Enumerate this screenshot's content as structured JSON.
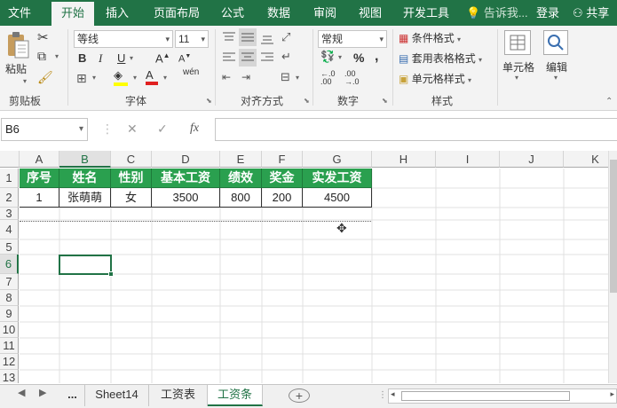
{
  "menu": {
    "tabs": [
      "文件",
      "开始",
      "插入",
      "页面布局",
      "公式",
      "数据",
      "审阅",
      "视图",
      "开发工具"
    ],
    "active_tab": "开始",
    "search": "告诉我...",
    "login": "登录",
    "share": "共享"
  },
  "ribbon": {
    "clipboard": {
      "paste": "粘贴",
      "label": "剪贴板"
    },
    "font": {
      "name": "等线",
      "size": "11",
      "label": "字体",
      "bold": "B",
      "italic": "I",
      "underline": "U",
      "grow": "A",
      "shrink": "A",
      "wen": "wén"
    },
    "alignment": {
      "label": "对齐方式"
    },
    "number": {
      "format": "常规",
      "label": "数字",
      "percent": "%",
      "comma": ","
    },
    "styles": {
      "conditional": "条件格式",
      "table": "套用表格格式",
      "cell": "单元格样式",
      "label": "样式"
    },
    "cells": {
      "label": "单元格"
    },
    "editing": {
      "label": "编辑"
    }
  },
  "formula_bar": {
    "name_box": "B6",
    "cancel": "✕",
    "enter": "✓",
    "fx": "fx",
    "value": ""
  },
  "columns": [
    "A",
    "B",
    "C",
    "D",
    "E",
    "F",
    "G",
    "H",
    "I",
    "J",
    "K"
  ],
  "rows": [
    "1",
    "2",
    "3",
    "4",
    "5",
    "6",
    "7",
    "8",
    "9",
    "10",
    "11",
    "12",
    "13"
  ],
  "table": {
    "headers": [
      "序号",
      "姓名",
      "性别",
      "基本工资",
      "绩效",
      "奖金",
      "实发工资"
    ],
    "rows": [
      [
        "1",
        "张萌萌",
        "女",
        "3500",
        "800",
        "200",
        "4500"
      ]
    ]
  },
  "selected_cell": "B6",
  "sheets": {
    "nav_prev": "◀",
    "nav_next": "▶",
    "ellipsis": "...",
    "tabs": [
      "Sheet14",
      "工资表",
      "工资条"
    ],
    "active": "工资条",
    "add": "+"
  },
  "colors": {
    "accent": "#217346",
    "header_fill": "#2aa04f"
  }
}
